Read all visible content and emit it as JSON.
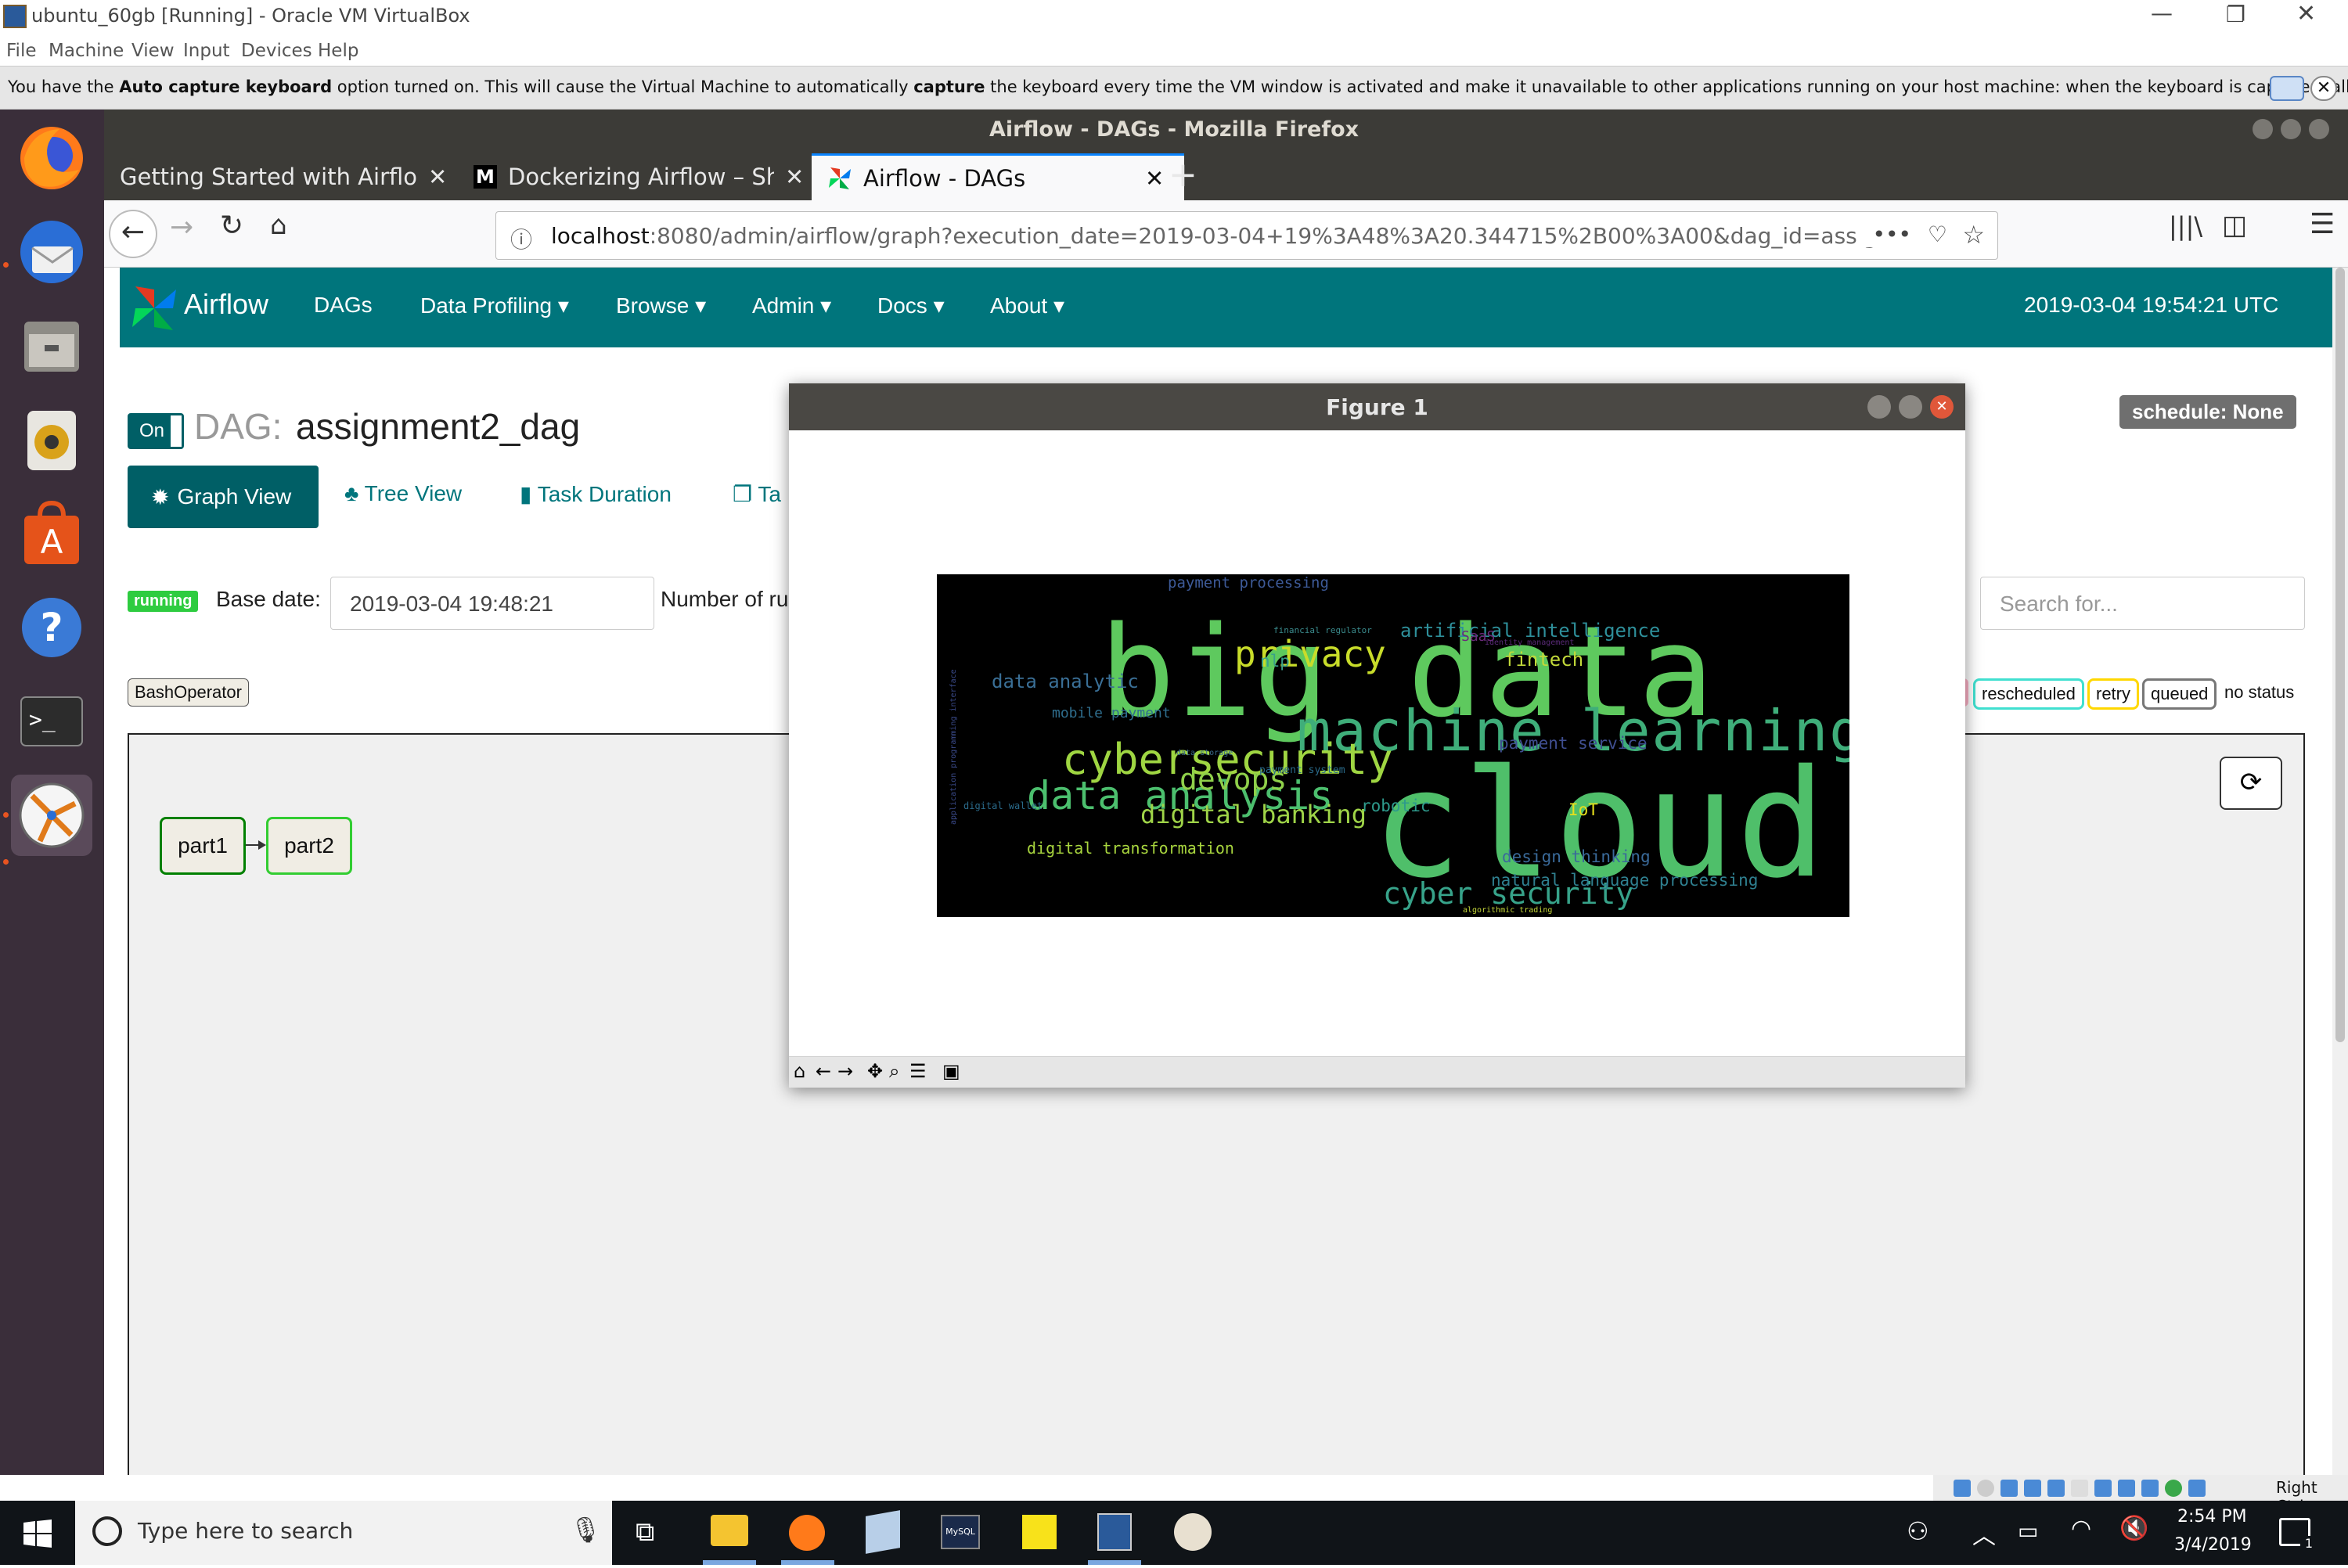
{
  "vbox": {
    "title": "ubuntu_60gb [Running] - Oracle VM VirtualBox",
    "menu": [
      "File",
      "Machine",
      "View",
      "Input",
      "Devices",
      "Help"
    ],
    "info_prefix": "You have the ",
    "info_bold1": "Auto capture keyboard",
    "info_mid": " option turned on. This will cause the Virtual Machine to automatically ",
    "info_bold2": "capture",
    "info_suffix": " the keyboard every time the VM window is activated and make it unavailable to other applications running on your host machine: when the keyboard is captured, all keystrokes (including",
    "status_key": "Right Ctrl"
  },
  "ubuntu": {
    "window_title": "Airflow - DAGs - Mozilla Firefox"
  },
  "firefox": {
    "tabs": [
      {
        "label": "Getting Started with Airflow"
      },
      {
        "label": "Dockerizing Airflow – Sh"
      },
      {
        "label": "Airflow - DAGs"
      }
    ],
    "url_host": "localhost",
    "url_rest": ":8080/admin/airflow/graph?execution_date=2019-03-04+19%3A48%3A20.344715%2B00%3A00&dag_id=assign",
    "url_ellipsis": "•••"
  },
  "airflow": {
    "brand": "Airflow",
    "nav": [
      "DAGs",
      "Data Profiling",
      "Browse",
      "Admin",
      "Docs",
      "About"
    ],
    "clock": "2019-03-04 19:54:21 UTC",
    "toggle": "On",
    "dag_prefix": "DAG:",
    "dag_name": "assignment2_dag",
    "schedule": "schedule: None",
    "views": [
      "Graph View",
      "Tree View",
      "Task Duration",
      "Ta"
    ],
    "state_badge": "running",
    "base_date_label": "Base date:",
    "base_date_value": "2019-03-04 19:48:21",
    "num_runs_label": "Number of ru",
    "search_placeholder": "Search for...",
    "operator": "BashOperator",
    "legend": [
      "rescheduled",
      "retry",
      "queued",
      "no status"
    ],
    "tasks": [
      "part1",
      "part2"
    ]
  },
  "figure": {
    "title": "Figure 1",
    "wordcloud": [
      {
        "t": "big data",
        "c": "#5ec95e"
      },
      {
        "t": "cloud",
        "c": "#4fbf6a"
      },
      {
        "t": "machine learning",
        "c": "#3fae7a"
      },
      {
        "t": "cybersecurity",
        "c": "#9fd642"
      },
      {
        "t": "privacy",
        "c": "#c8dc2a"
      },
      {
        "t": "data analysis",
        "c": "#4cbf6e"
      },
      {
        "t": "devops",
        "c": "#8fd04a"
      },
      {
        "t": "digital banking",
        "c": "#9fd448"
      },
      {
        "t": "cyber security",
        "c": "#37a38a"
      },
      {
        "t": "data analytic",
        "c": "#3a6f96"
      },
      {
        "t": "fintech",
        "c": "#c2d93a"
      },
      {
        "t": "artificial intelligence",
        "c": "#2e8f9a"
      },
      {
        "t": "digital transformation",
        "c": "#a8d53e"
      },
      {
        "t": "payment processing",
        "c": "#3d5a98"
      },
      {
        "t": "payment service",
        "c": "#3f4e90"
      },
      {
        "t": "natural language processing",
        "c": "#2f8090"
      },
      {
        "t": "design thinking",
        "c": "#3a6a9a"
      },
      {
        "t": "robotic",
        "c": "#2e9a8c"
      },
      {
        "t": "IoT",
        "c": "#e6e01c"
      },
      {
        "t": "nlp",
        "c": "#3aa08a"
      },
      {
        "t": "SaaS",
        "c": "#6b2a7a"
      },
      {
        "t": "mobile payment",
        "c": "#2f6e8e"
      },
      {
        "t": "digital wallet",
        "c": "#2a6a8a"
      },
      {
        "t": "payment system",
        "c": "#2a6a8a"
      },
      {
        "t": "financial regulator",
        "c": "#3a8a8c"
      },
      {
        "t": "identity management",
        "c": "#5a2a78"
      },
      {
        "t": "algorithmic trading",
        "c": "#c4d63a"
      },
      {
        "t": "data storage",
        "c": "#3a6a8a"
      },
      {
        "t": "application programming interface",
        "c": "#3a4a8a"
      }
    ]
  },
  "taskbar": {
    "search_placeholder": "Type here to search",
    "time": "2:54 PM",
    "date": "3/4/2019",
    "notif_count": "1",
    "apps": [
      "task-view",
      "file-explorer",
      "firefox",
      "virtualbox-cube",
      "mysql-workbench",
      "sticky-notes",
      "virtualbox",
      "paint"
    ]
  },
  "colors": {
    "airflow_nav": "#00757c",
    "graph_view_btn": "#005f66",
    "running_badge": "#2ecc40",
    "wordcloud_bg": "#000000",
    "ubuntu_dock": "#3a2e3a"
  }
}
